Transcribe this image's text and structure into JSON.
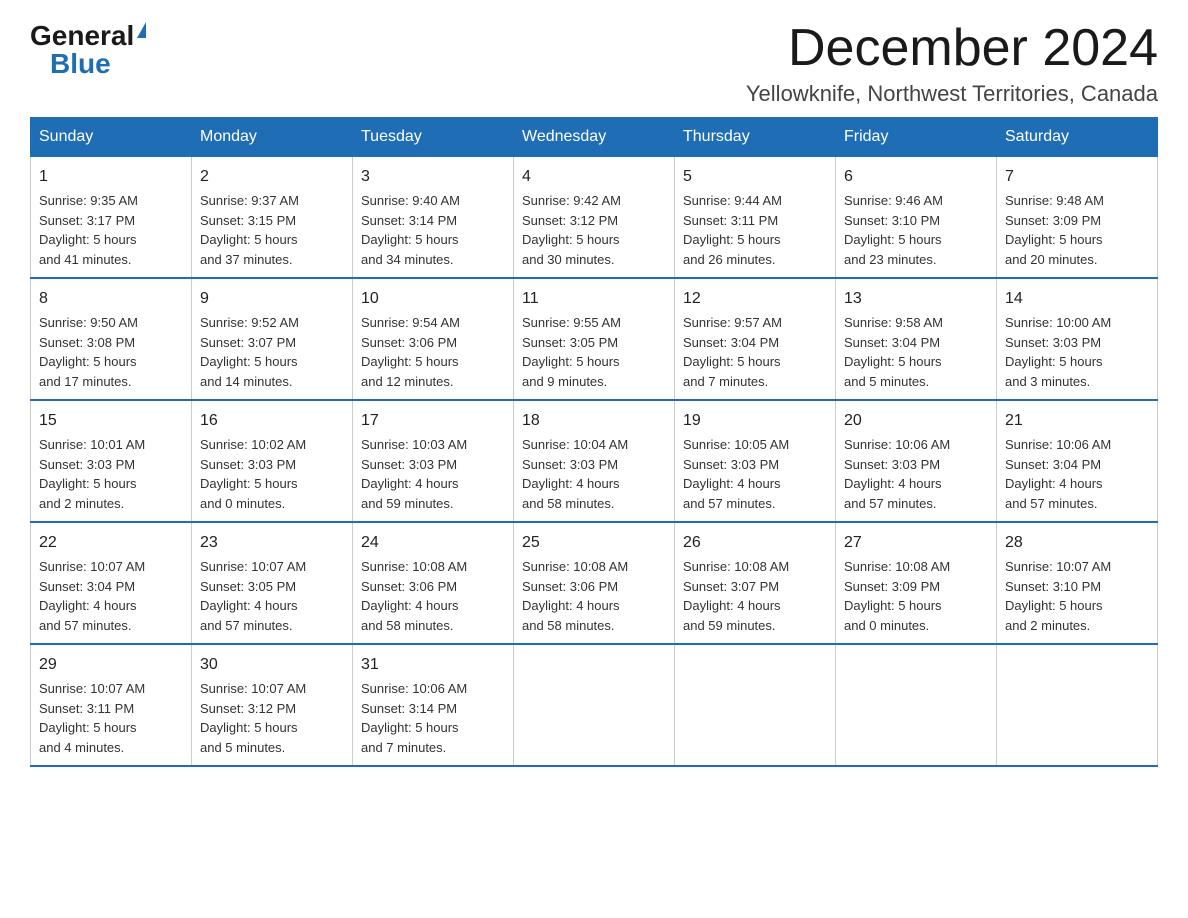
{
  "logo": {
    "general": "General",
    "blue": "Blue",
    "triangle": "▶"
  },
  "title": "December 2024",
  "subtitle": "Yellowknife, Northwest Territories, Canada",
  "days_of_week": [
    "Sunday",
    "Monday",
    "Tuesday",
    "Wednesday",
    "Thursday",
    "Friday",
    "Saturday"
  ],
  "weeks": [
    [
      {
        "day": "1",
        "info": "Sunrise: 9:35 AM\nSunset: 3:17 PM\nDaylight: 5 hours\nand 41 minutes."
      },
      {
        "day": "2",
        "info": "Sunrise: 9:37 AM\nSunset: 3:15 PM\nDaylight: 5 hours\nand 37 minutes."
      },
      {
        "day": "3",
        "info": "Sunrise: 9:40 AM\nSunset: 3:14 PM\nDaylight: 5 hours\nand 34 minutes."
      },
      {
        "day": "4",
        "info": "Sunrise: 9:42 AM\nSunset: 3:12 PM\nDaylight: 5 hours\nand 30 minutes."
      },
      {
        "day": "5",
        "info": "Sunrise: 9:44 AM\nSunset: 3:11 PM\nDaylight: 5 hours\nand 26 minutes."
      },
      {
        "day": "6",
        "info": "Sunrise: 9:46 AM\nSunset: 3:10 PM\nDaylight: 5 hours\nand 23 minutes."
      },
      {
        "day": "7",
        "info": "Sunrise: 9:48 AM\nSunset: 3:09 PM\nDaylight: 5 hours\nand 20 minutes."
      }
    ],
    [
      {
        "day": "8",
        "info": "Sunrise: 9:50 AM\nSunset: 3:08 PM\nDaylight: 5 hours\nand 17 minutes."
      },
      {
        "day": "9",
        "info": "Sunrise: 9:52 AM\nSunset: 3:07 PM\nDaylight: 5 hours\nand 14 minutes."
      },
      {
        "day": "10",
        "info": "Sunrise: 9:54 AM\nSunset: 3:06 PM\nDaylight: 5 hours\nand 12 minutes."
      },
      {
        "day": "11",
        "info": "Sunrise: 9:55 AM\nSunset: 3:05 PM\nDaylight: 5 hours\nand 9 minutes."
      },
      {
        "day": "12",
        "info": "Sunrise: 9:57 AM\nSunset: 3:04 PM\nDaylight: 5 hours\nand 7 minutes."
      },
      {
        "day": "13",
        "info": "Sunrise: 9:58 AM\nSunset: 3:04 PM\nDaylight: 5 hours\nand 5 minutes."
      },
      {
        "day": "14",
        "info": "Sunrise: 10:00 AM\nSunset: 3:03 PM\nDaylight: 5 hours\nand 3 minutes."
      }
    ],
    [
      {
        "day": "15",
        "info": "Sunrise: 10:01 AM\nSunset: 3:03 PM\nDaylight: 5 hours\nand 2 minutes."
      },
      {
        "day": "16",
        "info": "Sunrise: 10:02 AM\nSunset: 3:03 PM\nDaylight: 5 hours\nand 0 minutes."
      },
      {
        "day": "17",
        "info": "Sunrise: 10:03 AM\nSunset: 3:03 PM\nDaylight: 4 hours\nand 59 minutes."
      },
      {
        "day": "18",
        "info": "Sunrise: 10:04 AM\nSunset: 3:03 PM\nDaylight: 4 hours\nand 58 minutes."
      },
      {
        "day": "19",
        "info": "Sunrise: 10:05 AM\nSunset: 3:03 PM\nDaylight: 4 hours\nand 57 minutes."
      },
      {
        "day": "20",
        "info": "Sunrise: 10:06 AM\nSunset: 3:03 PM\nDaylight: 4 hours\nand 57 minutes."
      },
      {
        "day": "21",
        "info": "Sunrise: 10:06 AM\nSunset: 3:04 PM\nDaylight: 4 hours\nand 57 minutes."
      }
    ],
    [
      {
        "day": "22",
        "info": "Sunrise: 10:07 AM\nSunset: 3:04 PM\nDaylight: 4 hours\nand 57 minutes."
      },
      {
        "day": "23",
        "info": "Sunrise: 10:07 AM\nSunset: 3:05 PM\nDaylight: 4 hours\nand 57 minutes."
      },
      {
        "day": "24",
        "info": "Sunrise: 10:08 AM\nSunset: 3:06 PM\nDaylight: 4 hours\nand 58 minutes."
      },
      {
        "day": "25",
        "info": "Sunrise: 10:08 AM\nSunset: 3:06 PM\nDaylight: 4 hours\nand 58 minutes."
      },
      {
        "day": "26",
        "info": "Sunrise: 10:08 AM\nSunset: 3:07 PM\nDaylight: 4 hours\nand 59 minutes."
      },
      {
        "day": "27",
        "info": "Sunrise: 10:08 AM\nSunset: 3:09 PM\nDaylight: 5 hours\nand 0 minutes."
      },
      {
        "day": "28",
        "info": "Sunrise: 10:07 AM\nSunset: 3:10 PM\nDaylight: 5 hours\nand 2 minutes."
      }
    ],
    [
      {
        "day": "29",
        "info": "Sunrise: 10:07 AM\nSunset: 3:11 PM\nDaylight: 5 hours\nand 4 minutes."
      },
      {
        "day": "30",
        "info": "Sunrise: 10:07 AM\nSunset: 3:12 PM\nDaylight: 5 hours\nand 5 minutes."
      },
      {
        "day": "31",
        "info": "Sunrise: 10:06 AM\nSunset: 3:14 PM\nDaylight: 5 hours\nand 7 minutes."
      },
      null,
      null,
      null,
      null
    ]
  ]
}
